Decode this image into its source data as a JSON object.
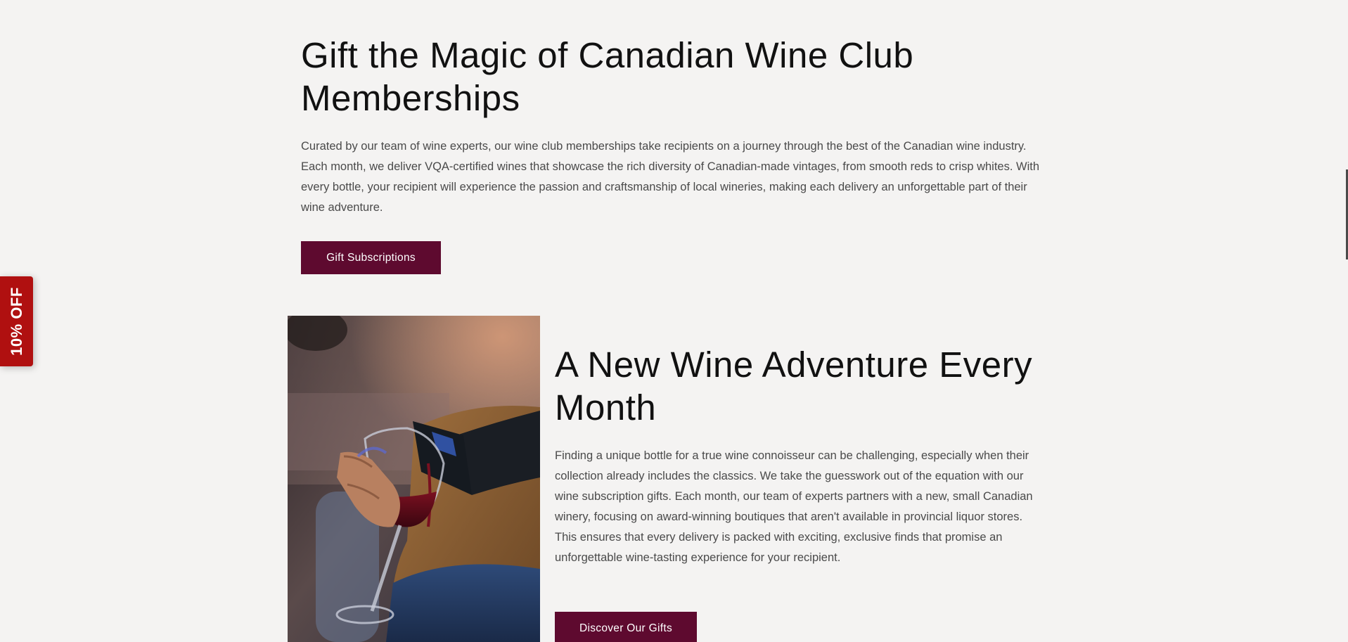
{
  "section_gift": {
    "title": "Gift the Magic of Canadian Wine Club Memberships",
    "body": "Curated by our team of wine experts, our wine club memberships take recipients on a journey through the best of the Canadian wine industry. Each month, we deliver VQA-certified wines that showcase the rich diversity of Canadian-made vintages, from smooth reds to crisp whites. With every bottle, your recipient will experience the passion and craftsmanship of local wineries, making each delivery an unforgettable part of their wine adventure.",
    "button_label": "Gift Subscriptions"
  },
  "section_adventure": {
    "title": "A New Wine Adventure Every Month",
    "body": "Finding a unique bottle for a true wine connoisseur can be challenging, especially when their collection already includes the classics. We take the guesswork out of the equation with our wine subscription gifts. Each month, our team of experts partners with a new, small Canadian winery, focusing on award-winning boutiques that aren't available in provincial liquor stores. This ensures that every delivery is packed with exciting, exclusive finds that promise an unforgettable wine-tasting experience for your recipient.",
    "button_label": "Discover Our Gifts"
  },
  "promo_tab": {
    "label": "10% OFF"
  },
  "colors": {
    "background": "#f4f3f2",
    "button": "#5e0a2f",
    "promo": "#b01010",
    "heading": "#111111",
    "body_text": "#4a4a4a"
  }
}
